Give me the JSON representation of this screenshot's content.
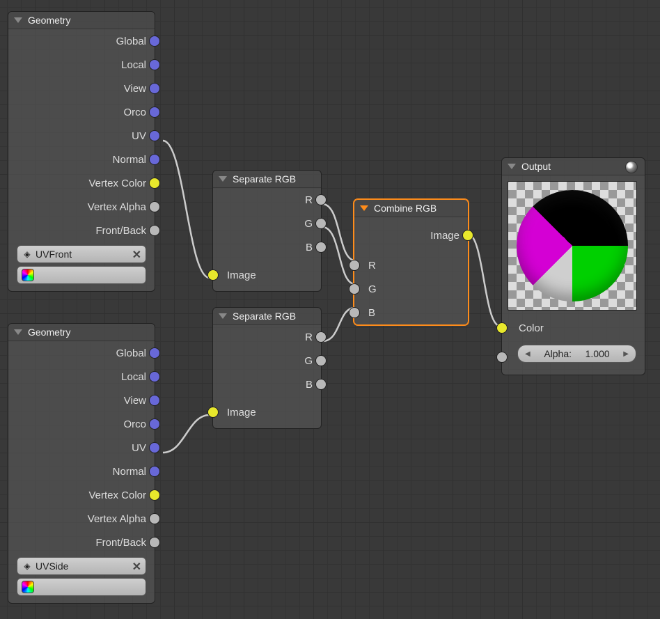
{
  "nodes": {
    "geo1": {
      "title": "Geometry",
      "outputs": [
        "Global",
        "Local",
        "View",
        "Orco",
        "UV",
        "Normal",
        "Vertex Color",
        "Vertex Alpha",
        "Front/Back"
      ],
      "uv_field": "UVFront"
    },
    "geo2": {
      "title": "Geometry",
      "outputs": [
        "Global",
        "Local",
        "View",
        "Orco",
        "UV",
        "Normal",
        "Vertex Color",
        "Vertex Alpha",
        "Front/Back"
      ],
      "uv_field": "UVSide"
    },
    "sep1": {
      "title": "Separate RGB",
      "outputs": [
        "R",
        "G",
        "B"
      ],
      "input": "Image"
    },
    "sep2": {
      "title": "Separate RGB",
      "outputs": [
        "R",
        "G",
        "B"
      ],
      "input": "Image"
    },
    "comb": {
      "title": "Combine RGB",
      "output": "Image",
      "inputs": [
        "R",
        "G",
        "B"
      ]
    },
    "out": {
      "title": "Output",
      "color_label": "Color",
      "alpha_label": "Alpha:",
      "alpha_value": "1.000"
    }
  }
}
